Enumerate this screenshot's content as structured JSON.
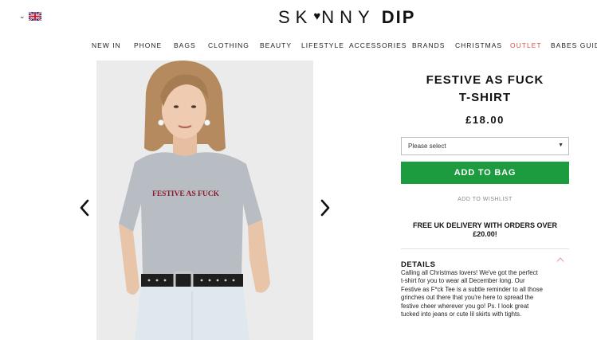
{
  "colors": {
    "accent_green": "#1d9b3f",
    "outlet_red": "#d9534f",
    "text": "#111111"
  },
  "header": {
    "locale_chevron": "⌄",
    "locale_icon": "uk-flag-icon",
    "logo_part1": "SK",
    "logo_heart": "♥",
    "logo_part2": "NNY",
    "logo_part3": "DIP"
  },
  "nav": {
    "items": [
      "NEW IN",
      "PHONE",
      "BAGS",
      "CLOTHING",
      "BEAUTY",
      "LIFESTYLE",
      "ACCESSORIES",
      "BRANDS",
      "CHRISTMAS",
      "OUTLET",
      "BABES GUIDE"
    ]
  },
  "gallery": {
    "prev_icon": "chevron-left-icon",
    "next_icon": "chevron-right-icon",
    "tee_print": "FESTIVE AS FUCK"
  },
  "product": {
    "title_line1": "FESTIVE AS FUCK",
    "title_line2": "T-SHIRT",
    "price": "£18.00",
    "size_select": "Please select",
    "add_to_bag": "ADD TO BAG",
    "add_to_wishlist": "ADD TO WISHLIST",
    "delivery_line1": "FREE UK DELIVERY WITH ORDERS OVER",
    "delivery_line2": "£20.00!",
    "details_label": "DETAILS",
    "details_lines": [
      "Calling all Christmas lovers! We've got the perfect",
      "t-shirt for you to wear all December long. Our",
      "Festive as F*ck Tee is a subtle reminder to all those",
      "grinches out there that you're here to spread the",
      "festive cheer wherever you go! Ps. I look great",
      "tucked into jeans or cute lil skirts with tights."
    ]
  }
}
